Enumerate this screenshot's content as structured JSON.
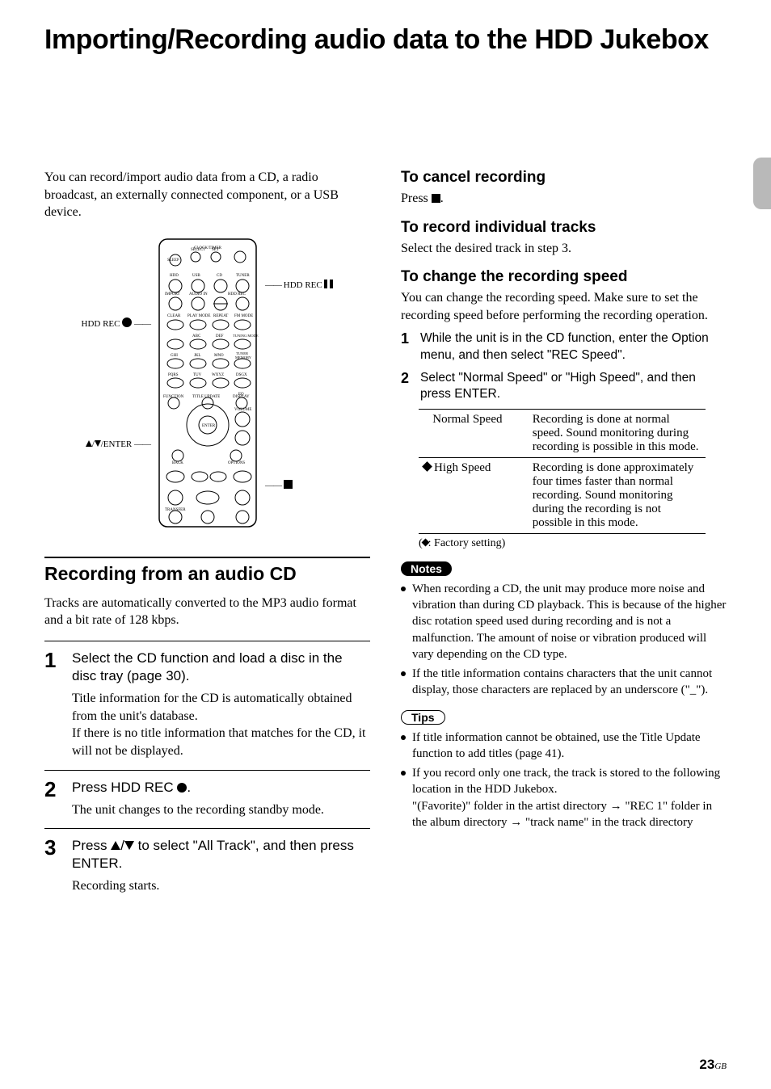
{
  "title": "Importing/Recording audio data to the HDD Jukebox",
  "intro": "You can record/import audio data from a CD, a radio broadcast, an externally connected component, or a USB device.",
  "remote_labels": {
    "left_top": "HDD REC",
    "left_bottom": "/ENTER",
    "right_top": "HDD REC"
  },
  "section": {
    "heading": "Recording from an audio CD",
    "lead": "Tracks are automatically converted to the MP3 audio format and a bit rate of 128 kbps.",
    "steps": [
      {
        "num": "1",
        "head": "Select the CD function and load a disc in the disc tray (page 30).",
        "desc": "Title information for the CD is automatically obtained from the unit's database.\nIf there is no title information that matches for the CD, it will not be displayed."
      },
      {
        "num": "2",
        "head_pre": "Press HDD REC ",
        "head_post": ".",
        "desc": "The unit changes to the recording standby mode."
      },
      {
        "num": "3",
        "head_pre": "Press ",
        "head_mid": " to select \"All Track\", and then press ENTER.",
        "desc": "Recording starts."
      }
    ]
  },
  "right": {
    "cancel": {
      "h": "To cancel recording",
      "body_pre": "Press ",
      "body_post": "."
    },
    "individual": {
      "h": "To record individual tracks",
      "body": "Select the desired track in step 3."
    },
    "speed": {
      "h": "To change the recording speed",
      "body": "You can change the recording speed. Make sure to set the recording speed before performing the recording operation.",
      "steps": [
        {
          "num": "1",
          "body": "While the unit is in the CD function, enter the Option menu, and then select \"REC Speed\"."
        },
        {
          "num": "2",
          "body": "Select \"Normal Speed\" or \"High Speed\", and then press ENTER."
        }
      ],
      "table": [
        {
          "label": "Normal Speed",
          "desc": "Recording is done at normal speed. Sound monitoring during recording is possible in this mode."
        },
        {
          "label": "High Speed",
          "desc": "Recording is done approximately four times faster than normal recording. Sound monitoring during the recording is not possible in this mode.",
          "factory": true
        }
      ],
      "factory_note": ": Factory setting)"
    },
    "notes": {
      "label": "Notes",
      "items": [
        "When recording a CD, the unit may produce more noise and vibration than during CD playback. This is because of the higher disc rotation speed used during recording and is not a malfunction. The amount of noise or vibration produced will vary depending on the CD type.",
        "If the title information contains characters that the unit cannot display, those characters are replaced by an underscore (\"_\")."
      ]
    },
    "tips": {
      "label": "Tips",
      "items": [
        "If title information cannot be obtained, use the Title Update function to add titles (page 41).",
        "If you record only one track, the track is stored to the following location in the HDD Jukebox.\n\"(Favorite)\" folder in the artist directory → \"REC 1\" folder in the album directory → \"track name\" in the track directory"
      ]
    }
  },
  "page_number": "23",
  "page_region": "GB"
}
